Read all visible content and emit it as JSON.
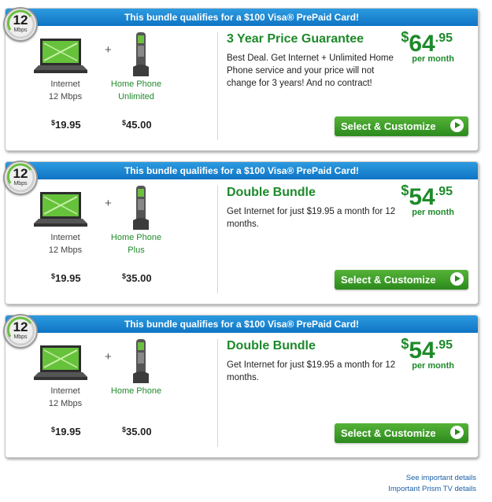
{
  "bundles": [
    {
      "banner": "This bundle qualifies for a $100 Visa® PrePaid Card!",
      "speed_badge": {
        "value": "12",
        "unit": "Mbps"
      },
      "internet": {
        "name": "Internet",
        "detail": "12 Mbps",
        "price": "19.95"
      },
      "phone": {
        "name": "Home Phone",
        "detail": "Unlimited",
        "price": "45.00"
      },
      "plus": "+",
      "currency": "$",
      "title": "3 Year Price Guarantee",
      "description": "Best Deal. Get Internet + Unlimited Home Phone service and your price will not change for 3 years! And no contract!",
      "price": {
        "whole": "64",
        "cents": ".95",
        "period": "per month"
      },
      "button": "Select & Customize"
    },
    {
      "banner": "This bundle qualifies for a $100 Visa® PrePaid Card!",
      "speed_badge": {
        "value": "12",
        "unit": "Mbps"
      },
      "internet": {
        "name": "Internet",
        "detail": "12 Mbps",
        "price": "19.95"
      },
      "phone": {
        "name": "Home Phone",
        "detail": "Plus",
        "price": "35.00"
      },
      "plus": "+",
      "currency": "$",
      "title": "Double Bundle",
      "description": "Get Internet for just $19.95 a month for 12 months.",
      "price": {
        "whole": "54",
        "cents": ".95",
        "period": "per month"
      },
      "button": "Select & Customize"
    },
    {
      "banner": "This bundle qualifies for a $100 Visa® PrePaid Card!",
      "speed_badge": {
        "value": "12",
        "unit": "Mbps"
      },
      "internet": {
        "name": "Internet",
        "detail": "12 Mbps",
        "price": "19.95"
      },
      "phone": {
        "name": "Home Phone",
        "detail": "",
        "price": "35.00"
      },
      "plus": "+",
      "currency": "$",
      "title": "Double Bundle",
      "description": "Get Internet for just $19.95 a month for 12 months.",
      "price": {
        "whole": "54",
        "cents": ".95",
        "period": "per month"
      },
      "button": "Select & Customize"
    }
  ],
  "footer_links": [
    "See important details",
    "Important Prism TV details"
  ],
  "colors": {
    "banner_blue": "#1a86d4",
    "accent_green": "#1d8a2a",
    "button_green": "#3a9d27"
  },
  "icons": [
    "speed-gauge-icon",
    "laptop-icon",
    "cordless-phone-icon",
    "arrow-right-circle-icon"
  ]
}
